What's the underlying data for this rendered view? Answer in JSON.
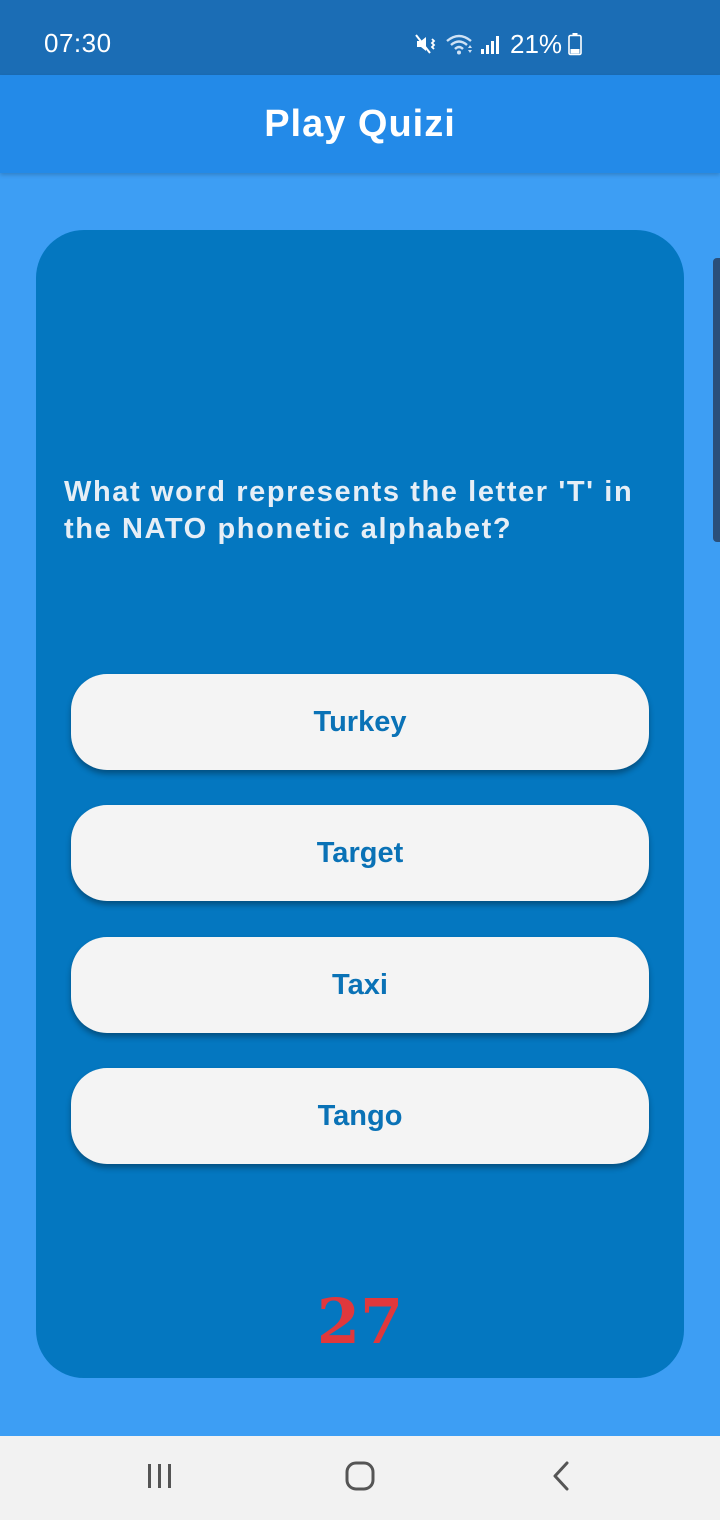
{
  "status_bar": {
    "time": "07:30",
    "battery_percent": "21%",
    "icons": [
      "mute-vibrate-icon",
      "wifi-icon",
      "signal-icon",
      "battery-icon"
    ]
  },
  "app_bar": {
    "title": "Play Quizi"
  },
  "quiz": {
    "question": "What word represents the letter 'T' in the NATO phonetic alphabet?",
    "answers": [
      "Turkey",
      "Target",
      "Taxi",
      "Tango"
    ],
    "timer": "27"
  },
  "nav_bar": {
    "icons": [
      "recent-apps-icon",
      "home-icon",
      "back-icon"
    ]
  },
  "colors": {
    "status_bar": "#1b6db5",
    "app_bar": "#238ae8",
    "background": "#3d9ef4",
    "card": "#0477c0",
    "answer_bg": "#f4f4f4",
    "answer_text": "#0a72b6",
    "timer": "#e0383c",
    "nav_bar": "#f2f2f2"
  }
}
